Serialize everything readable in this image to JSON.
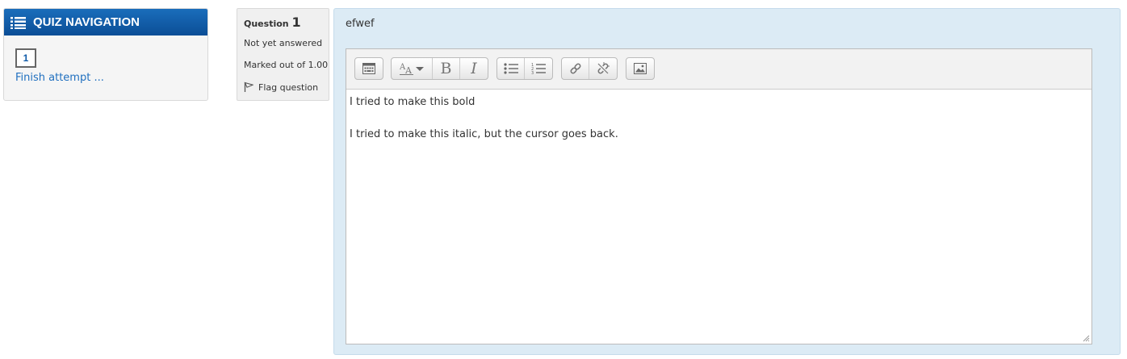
{
  "quiz_nav": {
    "title": "QUIZ NAVIGATION",
    "question_button": "1",
    "finish_link": "Finish attempt ..."
  },
  "question_info": {
    "label": "Question",
    "number": "1",
    "state": "Not yet answered",
    "grade": "Marked out of 1.00",
    "flag": "Flag question"
  },
  "question": {
    "text": "efwef"
  },
  "editor": {
    "toolbar_icons": [
      "show-more-buttons-icon",
      "text-style-icon",
      "bold-icon",
      "italic-icon",
      "unordered-list-icon",
      "ordered-list-icon",
      "link-icon",
      "unlink-icon",
      "image-icon"
    ],
    "bold_glyph": "B",
    "italic_glyph": "I",
    "paragraphs": [
      "I tried to make this bold",
      "I tried to make this italic, but the cursor goes back."
    ]
  },
  "colors": {
    "nav_header": "#0b4e96",
    "link": "#1f6fbf",
    "formulation_bg": "#dcebf5"
  }
}
